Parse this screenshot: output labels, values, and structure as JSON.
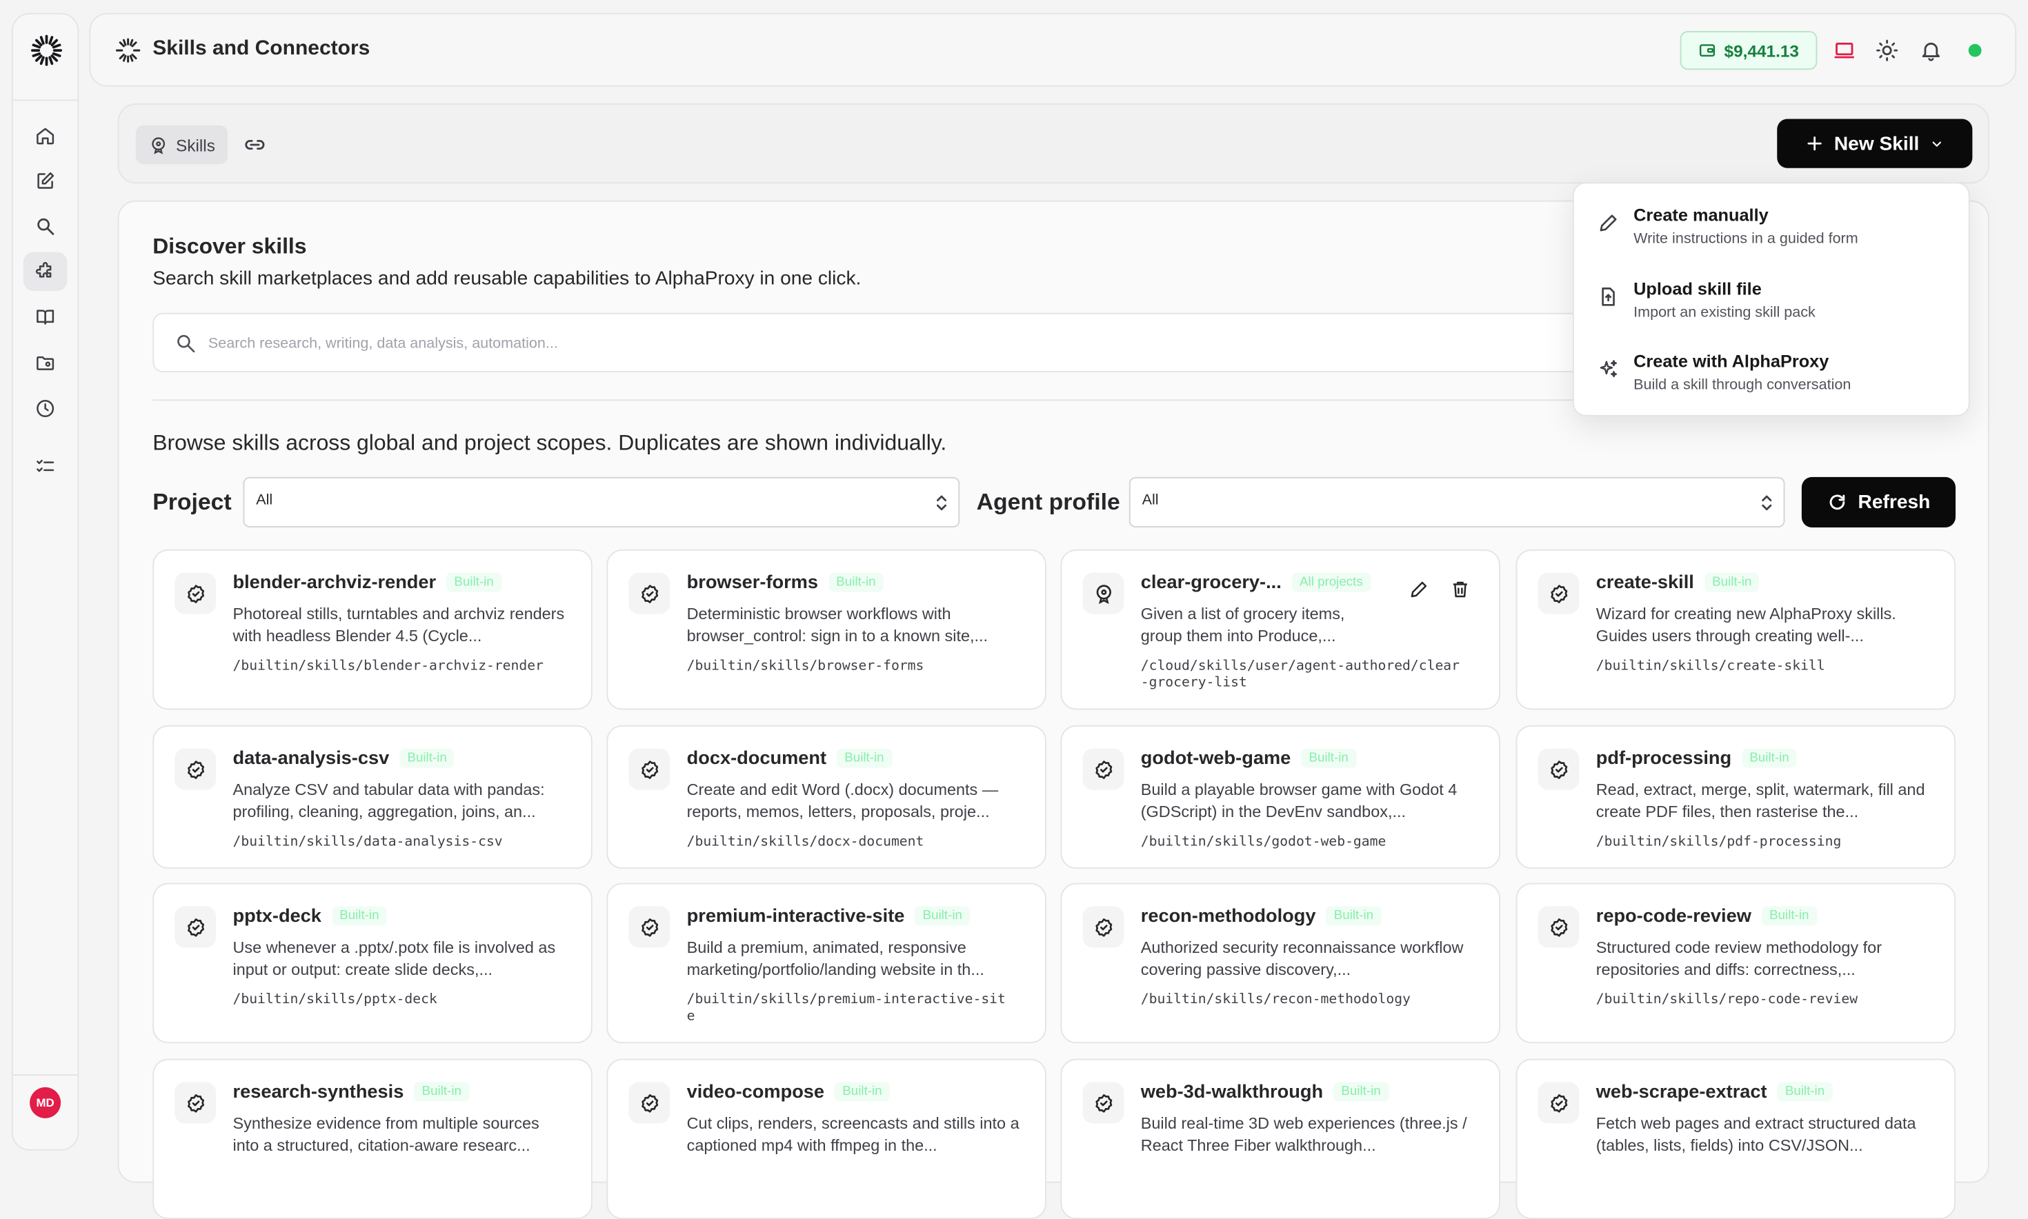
{
  "app": {
    "title": "Skills and Connectors",
    "balance": "$9,441.13",
    "avatar_initials": "MD"
  },
  "sidebar": {
    "items": [
      {
        "name": "home",
        "icon": "home-icon"
      },
      {
        "name": "new",
        "icon": "edit-icon"
      },
      {
        "name": "search",
        "icon": "search-icon"
      },
      {
        "name": "skills",
        "icon": "puzzle-icon",
        "active": true
      },
      {
        "name": "library",
        "icon": "book-icon"
      },
      {
        "name": "files",
        "icon": "folder-icon"
      },
      {
        "name": "history",
        "icon": "clock-icon"
      },
      {
        "name": "tasks",
        "icon": "checklist-icon"
      }
    ]
  },
  "tabs": {
    "skills_label": "Skills",
    "new_skill_label": "New Skill"
  },
  "new_skill_menu": [
    {
      "title": "Create manually",
      "subtitle": "Write instructions in a guided form",
      "icon": "pencil-icon"
    },
    {
      "title": "Upload skill file",
      "subtitle": "Import an existing skill pack",
      "icon": "file-upload-icon"
    },
    {
      "title": "Create with AlphaProxy",
      "subtitle": "Build a skill through conversation",
      "icon": "sparkles-icon"
    }
  ],
  "discover": {
    "title": "Discover skills",
    "subtitle": "Search skill marketplaces and add reusable capabilities to AlphaProxy in one click.",
    "search_placeholder": "Search research, writing, data analysis, automation..."
  },
  "browse": {
    "text": "Browse skills across global and project scopes. Duplicates are shown individually.",
    "project_label": "Project",
    "project_value": "All",
    "agent_label": "Agent profile",
    "agent_value": "All",
    "refresh_label": "Refresh"
  },
  "skills": [
    {
      "name": "blender-archviz-render",
      "badge": "Built-in",
      "desc": "Photoreal stills, turntables and archviz renders with headless Blender 4.5 (Cycle...",
      "path": "/builtin/skills/blender-archviz-render"
    },
    {
      "name": "browser-forms",
      "badge": "Built-in",
      "desc": "Deterministic browser workflows with browser_control: sign in to a known site,...",
      "path": "/builtin/skills/browser-forms"
    },
    {
      "name": "clear-grocery-...",
      "badge": "All projects",
      "desc": "Given a list of grocery items, group them into Produce,...",
      "path": "/cloud/skills/user/agent-authored/clear-grocery-list",
      "editable": true
    },
    {
      "name": "create-skill",
      "badge": "Built-in",
      "desc": "Wizard for creating new AlphaProxy skills. Guides users through creating well-...",
      "path": "/builtin/skills/create-skill"
    },
    {
      "name": "data-analysis-csv",
      "badge": "Built-in",
      "desc": "Analyze CSV and tabular data with pandas: profiling, cleaning, aggregation, joins, an...",
      "path": "/builtin/skills/data-analysis-csv"
    },
    {
      "name": "docx-document",
      "badge": "Built-in",
      "desc": "Create and edit Word (.docx) documents — reports, memos, letters, proposals, proje...",
      "path": "/builtin/skills/docx-document"
    },
    {
      "name": "godot-web-game",
      "badge": "Built-in",
      "desc": "Build a playable browser game with Godot 4 (GDScript) in the DevEnv sandbox,...",
      "path": "/builtin/skills/godot-web-game"
    },
    {
      "name": "pdf-processing",
      "badge": "Built-in",
      "desc": "Read, extract, merge, split, watermark, fill and create PDF files, then rasterise the...",
      "path": "/builtin/skills/pdf-processing"
    },
    {
      "name": "pptx-deck",
      "badge": "Built-in",
      "desc": "Use whenever a .pptx/.potx file is involved as input or output: create slide decks,...",
      "path": "/builtin/skills/pptx-deck"
    },
    {
      "name": "premium-interactive-site",
      "badge": "Built-in",
      "desc": "Build a premium, animated, responsive marketing/portfolio/landing website in th...",
      "path": "/builtin/skills/premium-interactive-site"
    },
    {
      "name": "recon-methodology",
      "badge": "Built-in",
      "desc": "Authorized security reconnaissance workflow covering passive discovery,...",
      "path": "/builtin/skills/recon-methodology"
    },
    {
      "name": "repo-code-review",
      "badge": "Built-in",
      "desc": "Structured code review methodology for repositories and diffs: correctness,...",
      "path": "/builtin/skills/repo-code-review"
    },
    {
      "name": "research-synthesis",
      "badge": "Built-in",
      "desc": "Synthesize evidence from multiple sources into a structured, citation-aware researc...",
      "path": ""
    },
    {
      "name": "video-compose",
      "badge": "Built-in",
      "desc": "Cut clips, renders, screencasts and stills into a captioned mp4 with ffmpeg in the...",
      "path": ""
    },
    {
      "name": "web-3d-walkthrough",
      "badge": "Built-in",
      "desc": "Build real-time 3D web experiences (three.js / React Three Fiber walkthrough...",
      "path": ""
    },
    {
      "name": "web-scrape-extract",
      "badge": "Built-in",
      "desc": "Fetch web pages and extract structured data (tables, lists, fields) into CSV/JSON...",
      "path": ""
    }
  ],
  "colors": {
    "accent": "#0a0a0a",
    "balance_green": "#15803d",
    "status_online": "#22c55e",
    "avatar_bg": "#e11d48"
  }
}
